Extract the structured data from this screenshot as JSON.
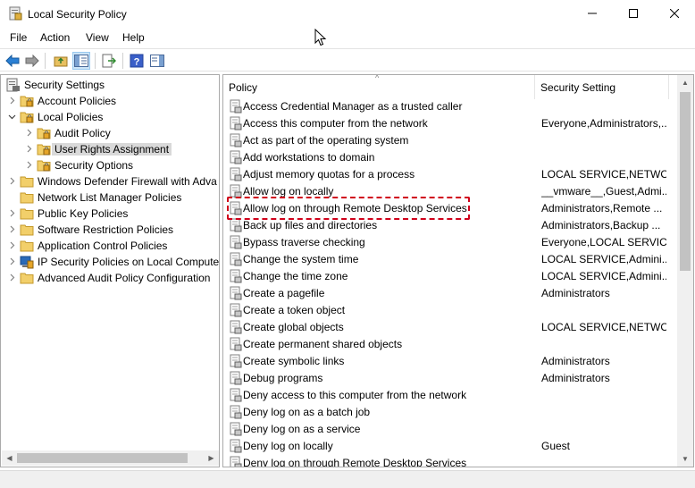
{
  "window": {
    "title": "Local Security Policy"
  },
  "menu": [
    "File",
    "Action",
    "View",
    "Help"
  ],
  "tree": [
    {
      "label": "Security Settings",
      "level": 0,
      "expander": "expanded",
      "icon": "security-settings-icon"
    },
    {
      "label": "Account Policies",
      "level": 1,
      "expander": "collapsed",
      "icon": "folder-lock-icon"
    },
    {
      "label": "Local Policies",
      "level": 1,
      "expander": "expanded",
      "icon": "folder-lock-icon"
    },
    {
      "label": "Audit Policy",
      "level": 2,
      "expander": "collapsed",
      "icon": "folder-lock-icon"
    },
    {
      "label": "User Rights Assignment",
      "level": 2,
      "expander": "collapsed",
      "icon": "folder-lock-icon",
      "selected": true
    },
    {
      "label": "Security Options",
      "level": 2,
      "expander": "collapsed",
      "icon": "folder-lock-icon"
    },
    {
      "label": "Windows Defender Firewall with Adva",
      "level": 1,
      "expander": "collapsed",
      "icon": "folder-icon"
    },
    {
      "label": "Network List Manager Policies",
      "level": 1,
      "expander": "none",
      "icon": "folder-icon"
    },
    {
      "label": "Public Key Policies",
      "level": 1,
      "expander": "collapsed",
      "icon": "folder-icon"
    },
    {
      "label": "Software Restriction Policies",
      "level": 1,
      "expander": "collapsed",
      "icon": "folder-icon"
    },
    {
      "label": "Application Control Policies",
      "level": 1,
      "expander": "collapsed",
      "icon": "folder-icon"
    },
    {
      "label": "IP Security Policies on Local Compute",
      "level": 1,
      "expander": "collapsed",
      "icon": "ip-security-icon"
    },
    {
      "label": "Advanced Audit Policy Configuration",
      "level": 1,
      "expander": "collapsed",
      "icon": "folder-icon"
    }
  ],
  "list": {
    "columns": [
      "Policy",
      "Security Setting"
    ],
    "rows": [
      {
        "policy": "Access Credential Manager as a trusted caller",
        "setting": ""
      },
      {
        "policy": "Access this computer from the network",
        "setting": "Everyone,Administrators,..."
      },
      {
        "policy": "Act as part of the operating system",
        "setting": ""
      },
      {
        "policy": "Add workstations to domain",
        "setting": ""
      },
      {
        "policy": "Adjust memory quotas for a process",
        "setting": "LOCAL SERVICE,NETWO..."
      },
      {
        "policy": "Allow log on locally",
        "setting": "__vmware__,Guest,Admi..."
      },
      {
        "policy": "Allow log on through Remote Desktop Services",
        "setting": "Administrators,Remote ...",
        "highlighted": true
      },
      {
        "policy": "Back up files and directories",
        "setting": "Administrators,Backup ..."
      },
      {
        "policy": "Bypass traverse checking",
        "setting": "Everyone,LOCAL SERVIC..."
      },
      {
        "policy": "Change the system time",
        "setting": "LOCAL SERVICE,Admini..."
      },
      {
        "policy": "Change the time zone",
        "setting": "LOCAL SERVICE,Admini..."
      },
      {
        "policy": "Create a pagefile",
        "setting": "Administrators"
      },
      {
        "policy": "Create a token object",
        "setting": ""
      },
      {
        "policy": "Create global objects",
        "setting": "LOCAL SERVICE,NETWO..."
      },
      {
        "policy": "Create permanent shared objects",
        "setting": ""
      },
      {
        "policy": "Create symbolic links",
        "setting": "Administrators"
      },
      {
        "policy": "Debug programs",
        "setting": "Administrators"
      },
      {
        "policy": "Deny access to this computer from the network",
        "setting": ""
      },
      {
        "policy": "Deny log on as a batch job",
        "setting": ""
      },
      {
        "policy": "Deny log on as a service",
        "setting": ""
      },
      {
        "policy": "Deny log on locally",
        "setting": "Guest"
      },
      {
        "policy": "Deny log on through Remote Desktop Services",
        "setting": ""
      }
    ]
  },
  "colors": {
    "highlight": "#d0021b",
    "selection": "#d9d9d9"
  }
}
